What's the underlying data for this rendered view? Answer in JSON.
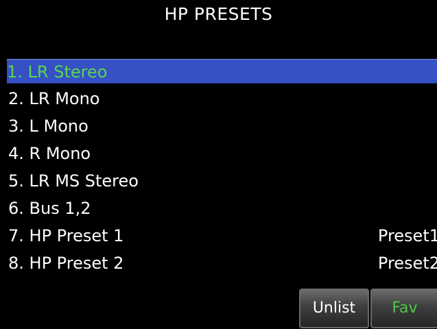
{
  "screen": {
    "title": "HP PRESETS"
  },
  "presets": [
    {
      "label": "1. LR Stereo",
      "value": "",
      "selected": true
    },
    {
      "label": "2. LR Mono",
      "value": "",
      "selected": false
    },
    {
      "label": "3. L Mono",
      "value": "",
      "selected": false
    },
    {
      "label": "4. R Mono",
      "value": "",
      "selected": false
    },
    {
      "label": "5. LR MS Stereo",
      "value": "",
      "selected": false
    },
    {
      "label": "6. Bus 1,2",
      "value": "",
      "selected": false
    },
    {
      "label": "7. HP Preset 1",
      "value": "Preset1",
      "selected": false
    },
    {
      "label": "8. HP Preset 2",
      "value": "Preset2",
      "selected": false
    }
  ],
  "buttons": {
    "unlist_label": "Unlist",
    "fav_label": "Fav"
  },
  "colors": {
    "background": "#000000",
    "selection": "#3551c4",
    "selected_text": "#59d64f",
    "fav_text": "#4fc94a",
    "text": "#ffffff"
  }
}
